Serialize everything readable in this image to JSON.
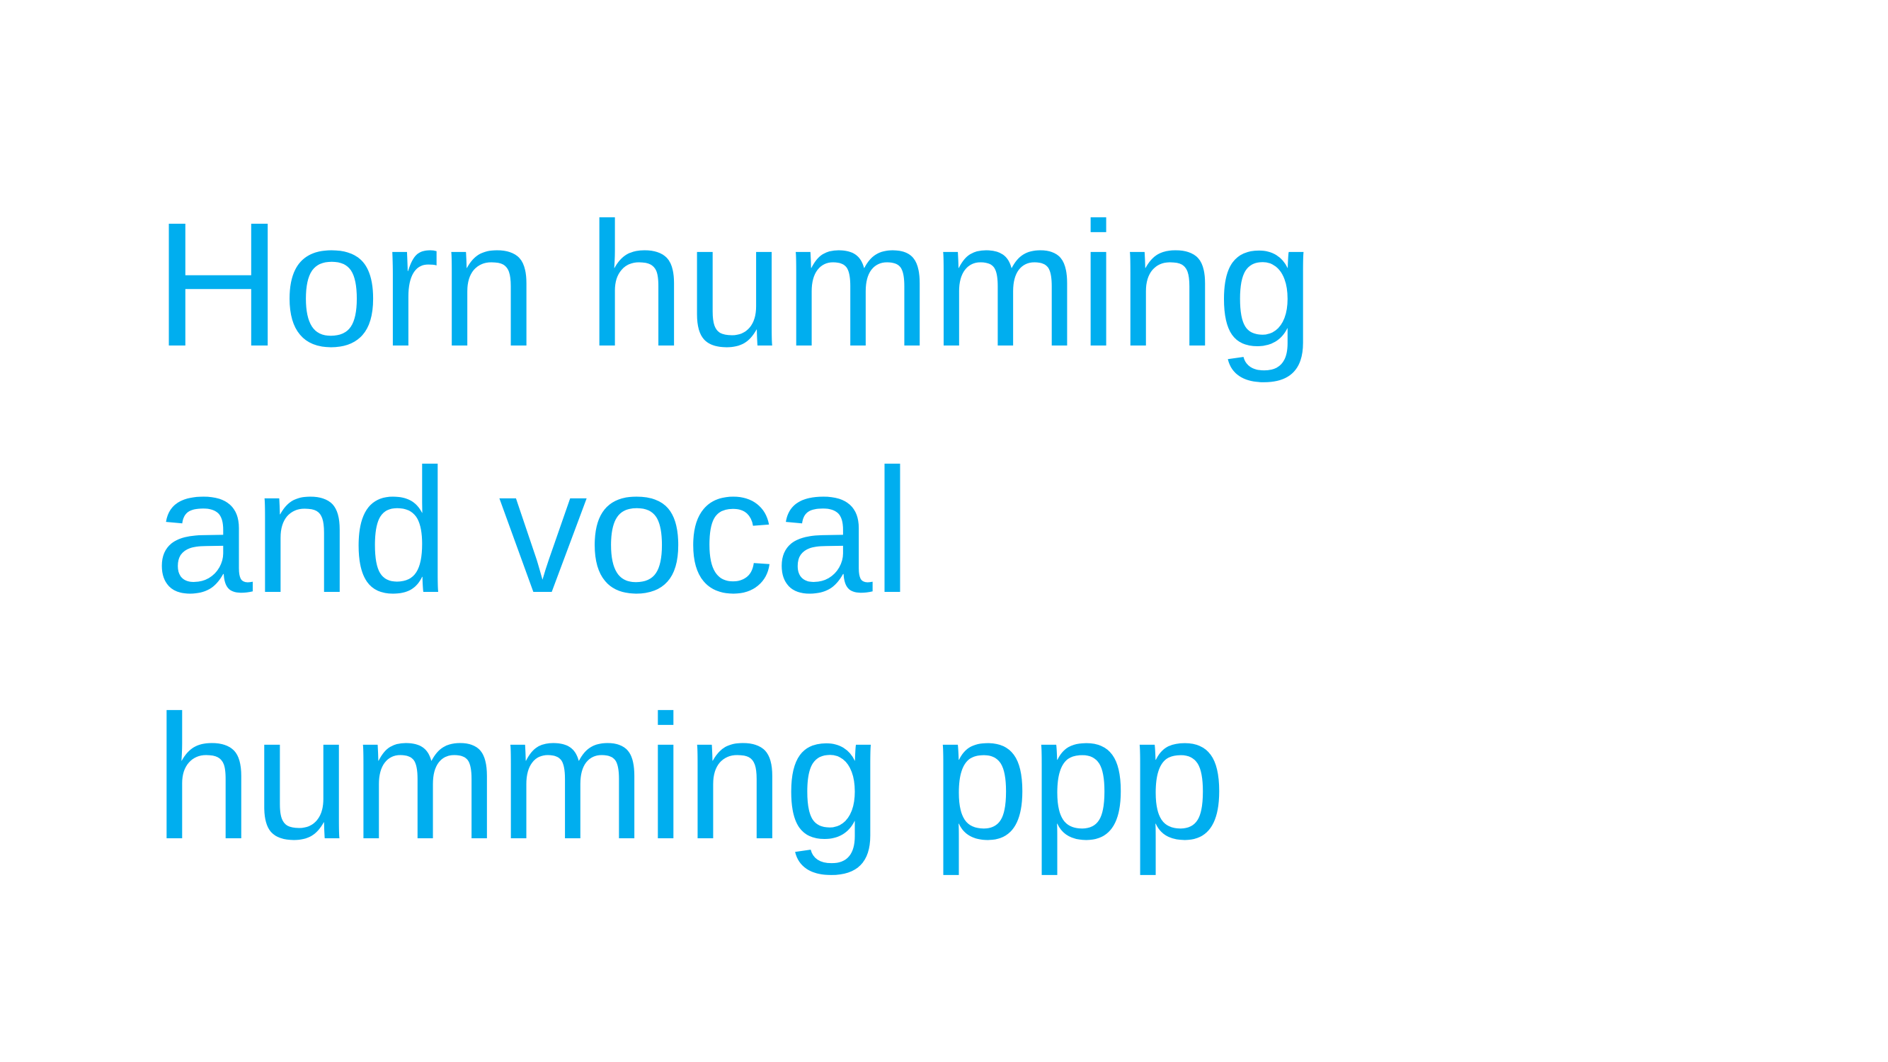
{
  "slide": {
    "lines": [
      "Horn humming",
      "and vocal",
      "humming ppp"
    ],
    "text_color": "#00AEEF",
    "background_color": "#FFFFFF"
  }
}
